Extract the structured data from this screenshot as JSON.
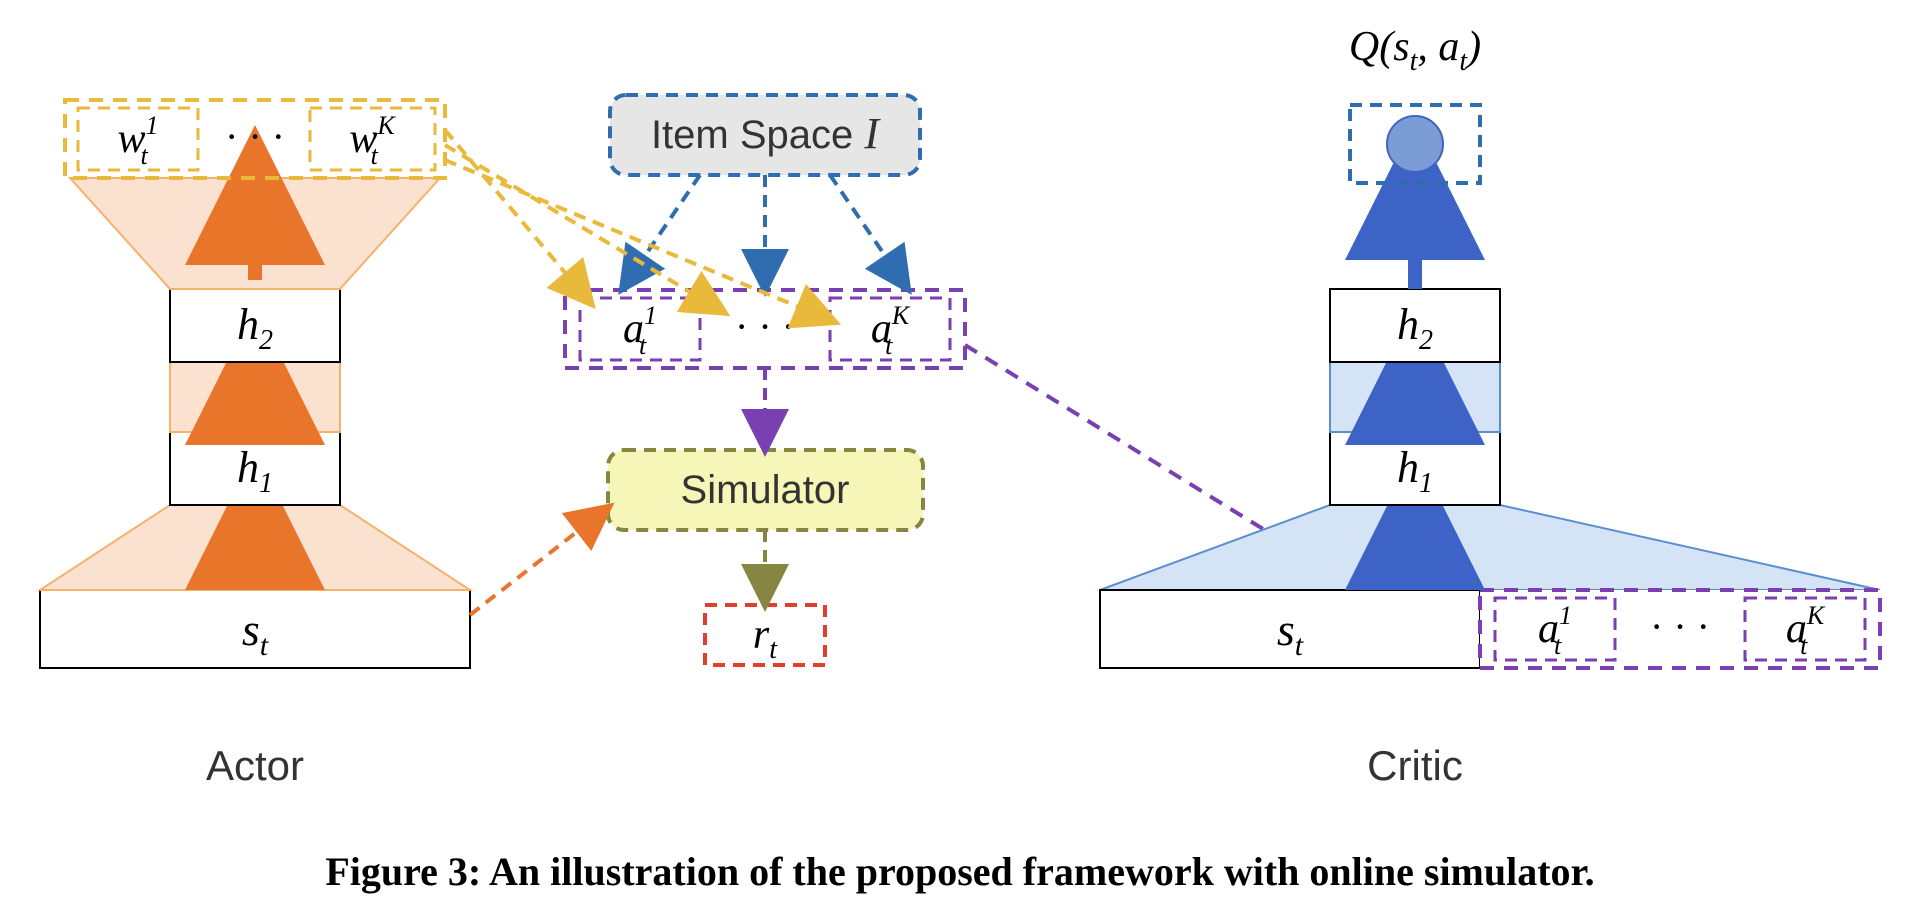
{
  "caption": "Figure 3: An illustration of the proposed framework with online simulator.",
  "actor": {
    "label": "Actor",
    "state": "s",
    "state_sub": "t",
    "h1": "h",
    "h1_sub": "1",
    "h2": "h",
    "h2_sub": "2",
    "w1": "w",
    "w1_sub": "t",
    "w1_sup": "1",
    "wK": "w",
    "wK_sub": "t",
    "wK_sup": "K",
    "dots": "· · ·"
  },
  "middle": {
    "item_space_label": "Item Space",
    "item_space_script": "I",
    "a1": "a",
    "a1_sub": "t",
    "a1_sup": "1",
    "aK": "a",
    "aK_sub": "t",
    "aK_sup": "K",
    "dots": "· · ·",
    "simulator": "Simulator",
    "reward": "r",
    "reward_sub": "t"
  },
  "critic": {
    "label": "Critic",
    "state": "s",
    "state_sub": "t",
    "a1": "a",
    "a1_sub": "t",
    "a1_sup": "1",
    "aK": "a",
    "aK_sub": "t",
    "aK_sup": "K",
    "dots": "· · ·",
    "h1": "h",
    "h1_sub": "1",
    "h2": "h",
    "h2_sub": "2",
    "Q_open": "Q(",
    "Q_s": "s",
    "Q_s_sub": "t",
    "Q_comma": ", ",
    "Q_a": "a",
    "Q_a_sub": "t",
    "Q_close": ")"
  },
  "colors": {
    "orange_fill": "#FBE1CF",
    "orange_stroke": "#F5B26B",
    "orange_arrow": "#E9752B",
    "yellow_dash": "#E9B93B",
    "blue_dash": "#2F6DB0",
    "purple_dash": "#7A3FB0",
    "olive_dash": "#868642",
    "olive_fill": "#F6F6B8",
    "red_dash": "#E33E2B",
    "grey_fill": "#E6E6E6",
    "critic_fill": "#D4E3F5",
    "critic_stroke": "#5A8FCE",
    "critic_arrow": "#3D63C6",
    "critic_node": "#7C9CD6"
  }
}
